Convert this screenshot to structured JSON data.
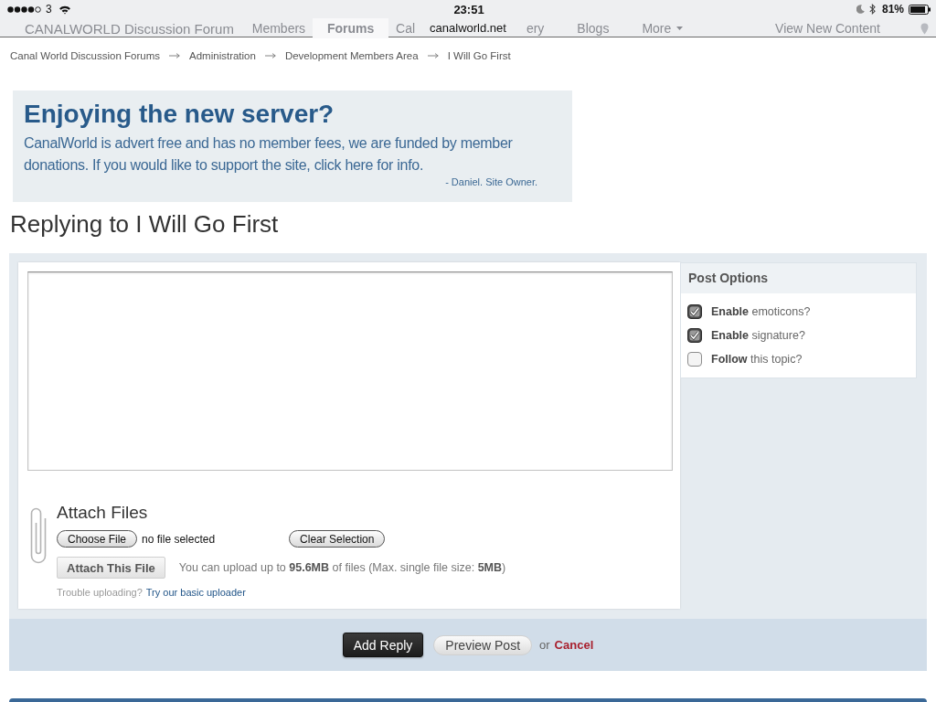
{
  "status_bar": {
    "carrier": "3",
    "time": "23:51",
    "url": "canalworld.net",
    "battery": "81%"
  },
  "nav": {
    "site_title": "CANALWORLD Discussion Forum",
    "left_items": [
      {
        "label": "Members",
        "selected": false,
        "dropdown": false
      },
      {
        "label": "Forums",
        "selected": true,
        "dropdown": false
      },
      {
        "label": "Cal",
        "selected": false,
        "dropdown": false
      }
    ],
    "right_items": [
      {
        "label": "ery",
        "selected": false,
        "dropdown": false
      },
      {
        "label": "Blogs",
        "selected": false,
        "dropdown": false
      },
      {
        "label": "More",
        "selected": false,
        "dropdown": true
      }
    ],
    "view_new_content": "View New Content"
  },
  "breadcrumb": [
    "Canal World Discussion Forums",
    "Administration",
    "Development Members Area",
    "I Will Go First"
  ],
  "banner": {
    "title": "Enjoying the new server?",
    "text": "CanalWorld is advert free and has no member fees, we are funded by member donations. If you would like to support the site, click here for info.",
    "signature": "- Daniel. Site Owner."
  },
  "heading": "Replying to I Will Go First",
  "attach": {
    "title": "Attach Files",
    "choose_button": "Choose File",
    "file_status": "no file selected",
    "clear_button": "Clear Selection",
    "attach_button": "Attach This File",
    "upload_info": "You can upload up to **95.6MB** of files (Max. single file size: **5MB**)",
    "help_text": "Trouble uploading?",
    "help_link": "Try our basic uploader"
  },
  "post_options": {
    "title": "Post Options",
    "options": [
      {
        "label": "**Enable** emoticons?",
        "checked": true
      },
      {
        "label": "**Enable** signature?",
        "checked": true
      },
      {
        "label": "**Follow** this topic?",
        "checked": false
      }
    ]
  },
  "actions": {
    "submit": "Add Reply",
    "preview": "Preview Post",
    "or": "or",
    "cancel": "Cancel"
  }
}
